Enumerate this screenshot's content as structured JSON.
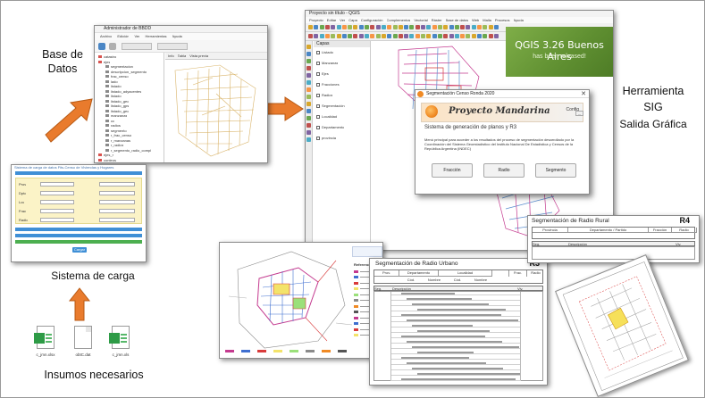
{
  "labels": {
    "base_datos_line1": "Base de",
    "base_datos_line2": "Datos",
    "herramienta": "Herramienta",
    "sig": "SIG",
    "salida": "Salida Gráfica",
    "sistema_carga": "Sistema de carga",
    "insumos": "Insumos necesarios",
    "r3": "R3",
    "r4": "R4"
  },
  "files": [
    {
      "name": "c_jmn.xlsx",
      "kind": "spreadsheet"
    },
    {
      "name": "obtC.dat",
      "kind": "document"
    },
    {
      "name": "c_jmn.xls",
      "kind": "spreadsheet"
    }
  ],
  "pgadmin": {
    "title": "Administrador de BBDD",
    "menu": [
      "Archivo",
      "Edición",
      "Ver",
      "Herramientas",
      "Ayuda"
    ],
    "tabs": [
      "Info",
      "Tabla",
      "Vista previa"
    ],
    "tree": [
      "catastro",
      "ejes",
      "segmentacion",
      "descripcion_segmento",
      "frac_censo",
      "lado",
      "listado",
      "listado_adyacentes",
      "listado",
      "listado_geo",
      "listado_gps",
      "listado_geo",
      "manzanas",
      "cc",
      "radios",
      "segmento",
      "r_frac_censo",
      "r_manzanas",
      "r_radios",
      "r_segmento_radio_compl",
      "ejes_r",
      "conteos"
    ]
  },
  "qgis": {
    "title": "Proyecto sin título - QGIS",
    "menu": [
      "Proyecto",
      "Editar",
      "Ver",
      "Capa",
      "Configuración",
      "Complementos",
      "Vectorial",
      "Ráster",
      "Base de datos",
      "Web",
      "Malla",
      "Procesos",
      "Ayuda"
    ],
    "layers_title": "Capas",
    "layers": [
      "Listado",
      "Manzanas",
      "Ejes",
      "Fracciones",
      "Radios",
      "Segmentación",
      "Localidad",
      "Departamento",
      "provincia"
    ],
    "banner_title": "QGIS 3.26 Buenos Aires",
    "banner_sub": "has been released!"
  },
  "dialog": {
    "title": "Segmentación Censo Ronda 2020",
    "brand": "Proyecto Mandarina",
    "config": "Config",
    "subtitle": "Sistema de generación de planos y R3",
    "desc": "Menú principal para acceder a los resultados del proceso de segmentación desarrollado por la Coordinación del Sistema Geoestadístico del Instituto Nacional De Estadística y Censos de la República Argentina (INDEC)",
    "buttons": [
      "Fracción",
      "Radio",
      "Segmento"
    ]
  },
  "form": {
    "title": "Sistema de carga de datos Fits-Censo de Viviendas y Hogares",
    "rows": [
      "Prov",
      "Dpto",
      "Loc",
      "Frac",
      "Radio"
    ],
    "submit": "Cargar"
  },
  "r3": {
    "title": "Segmentación de Radio Urbano",
    "headers": [
      "Prov.",
      "Departamento",
      "Localidad"
    ],
    "codes": [
      "Frac.",
      "Radio"
    ],
    "sub": [
      "Cód.",
      "Nombre",
      "Cód.",
      "Nombre"
    ],
    "cols": [
      "Seg.",
      "Descripción",
      "Viv."
    ]
  },
  "r4": {
    "title": "Segmentación de Radio Rural",
    "headers": [
      "Provincia",
      "Departamento / Partido",
      "Fracción",
      "Radio"
    ],
    "cols": [
      "Seg.",
      "Descripción",
      "Viv."
    ]
  },
  "map": {
    "legend_title": "Referencias",
    "scale": "0  100  200 m"
  },
  "colors": {
    "arrow_orange": "#e97b2d",
    "arrow_edge": "#b85a14",
    "qgis_green": "#6a9a3a",
    "form_blue": "#3f8fd6",
    "form_yellow": "#fbf3c7"
  }
}
